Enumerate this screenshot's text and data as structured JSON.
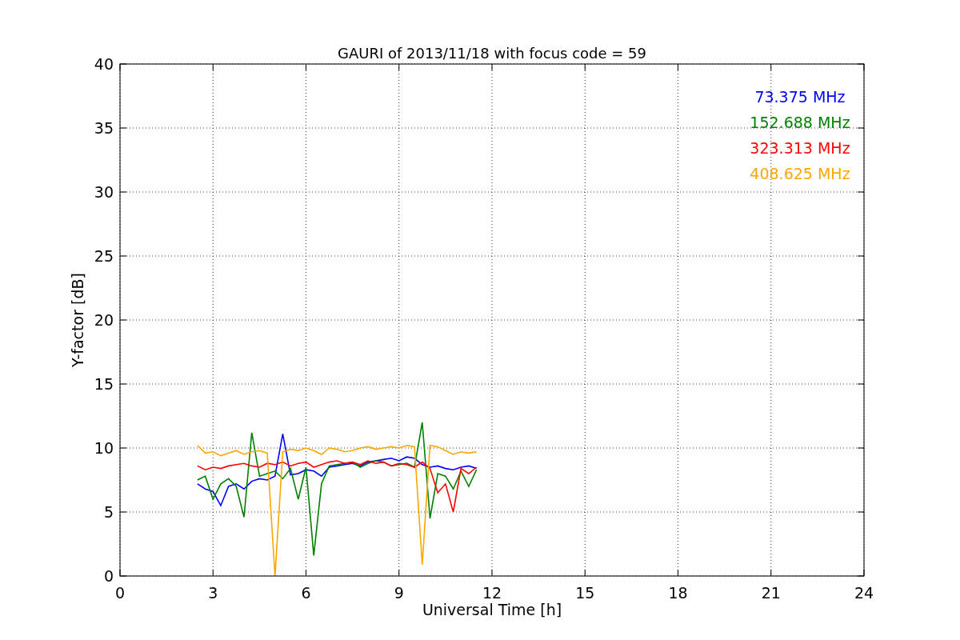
{
  "chart_data": {
    "type": "line",
    "title": "GAURI of 2013/11/18 with focus code = 59",
    "xlabel": "Universal Time [h]",
    "ylabel": "Y-factor [dB]",
    "x": [
      2.5,
      2.75,
      3,
      3.25,
      3.5,
      3.75,
      4,
      4.25,
      4.5,
      4.75,
      5,
      5.25,
      5.5,
      5.75,
      6,
      6.25,
      6.5,
      6.75,
      7,
      7.25,
      7.5,
      7.75,
      8,
      8.25,
      8.5,
      8.75,
      9,
      9.25,
      9.5,
      9.75,
      10,
      10.25,
      10.5,
      10.75,
      11,
      11.25,
      11.5
    ],
    "series": [
      {
        "name": "73.375 MHz",
        "color": "#0000ff",
        "values": [
          7.2,
          6.8,
          6.6,
          5.5,
          7.0,
          7.2,
          6.8,
          7.4,
          7.6,
          7.5,
          7.8,
          11.1,
          7.9,
          8.0,
          8.3,
          8.2,
          7.8,
          8.5,
          8.6,
          8.7,
          8.8,
          8.6,
          8.9,
          9.0,
          9.1,
          9.2,
          9.0,
          9.3,
          9.2,
          8.7,
          8.5,
          8.6,
          8.4,
          8.3,
          8.5,
          8.6,
          8.4
        ]
      },
      {
        "name": "152.688 MHz",
        "color": "#008000",
        "values": [
          7.5,
          7.8,
          6.0,
          7.2,
          7.6,
          7.0,
          4.6,
          11.2,
          7.8,
          8.0,
          8.2,
          7.6,
          8.4,
          6.0,
          8.5,
          1.6,
          7.2,
          8.6,
          8.7,
          8.8,
          8.9,
          8.5,
          8.8,
          9.0,
          8.9,
          8.6,
          8.7,
          8.8,
          8.5,
          12.0,
          4.5,
          8.0,
          7.8,
          6.8,
          8.2,
          7.0,
          8.3
        ]
      },
      {
        "name": "323.313 MHz",
        "color": "#ff0000",
        "values": [
          8.6,
          8.3,
          8.5,
          8.4,
          8.6,
          8.7,
          8.8,
          8.6,
          8.5,
          8.8,
          8.7,
          8.9,
          8.6,
          8.8,
          8.9,
          8.5,
          8.7,
          8.9,
          9.0,
          8.8,
          8.9,
          8.7,
          9.0,
          8.8,
          8.9,
          8.6,
          8.8,
          8.7,
          8.5,
          8.9,
          8.4,
          6.5,
          7.2,
          5.0,
          8.4,
          8.0,
          8.5
        ]
      },
      {
        "name": "408.625 MHz",
        "color": "#ffa500",
        "values": [
          10.2,
          9.6,
          9.7,
          9.4,
          9.6,
          9.8,
          9.5,
          9.7,
          9.8,
          9.6,
          0.0,
          9.7,
          9.9,
          9.8,
          10.0,
          9.8,
          9.5,
          10.0,
          9.9,
          9.7,
          9.8,
          10.0,
          10.1,
          9.9,
          10.0,
          10.1,
          10.0,
          10.2,
          10.1,
          0.9,
          10.2,
          10.1,
          9.8,
          9.5,
          9.7,
          9.6,
          9.7
        ]
      }
    ],
    "xlim": [
      0,
      24
    ],
    "ylim": [
      0,
      40
    ],
    "xticks": [
      0,
      3,
      6,
      9,
      12,
      15,
      18,
      21,
      24
    ],
    "yticks": [
      0,
      5,
      10,
      15,
      20,
      25,
      30,
      35,
      40
    ],
    "grid": true
  }
}
